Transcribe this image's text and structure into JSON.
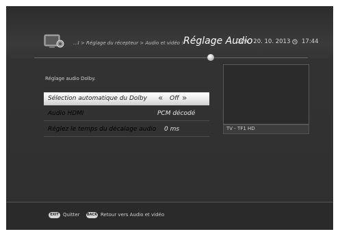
{
  "header": {
    "breadcrumb": "...I > Réglage du récepteur > Audio et vidéo >",
    "title": "Réglage Audio",
    "date": "Dim., 20. 10. 2013",
    "time": "17:44"
  },
  "section_label": "Réglage audio Dolby.",
  "settings": [
    {
      "label": "Sélection automatique du Dolby",
      "value": "Off",
      "selected": true
    },
    {
      "label": "Audio HDMI",
      "value": "PCM décodé"
    },
    {
      "label": "Réglez le temps du décalage audio",
      "value": "0 ms"
    }
  ],
  "preview": {
    "channel": "TV - TF1 HD"
  },
  "footer": {
    "exit_key": "EXIT",
    "exit_label": "Quitter",
    "back_key": "BACK",
    "back_label": "Retour vers Audio et vidéo"
  },
  "icons": {
    "app": "settings-tv-icon",
    "clock": "clock-icon",
    "left": "chevron-left-icon",
    "right": "chevron-right-icon"
  }
}
